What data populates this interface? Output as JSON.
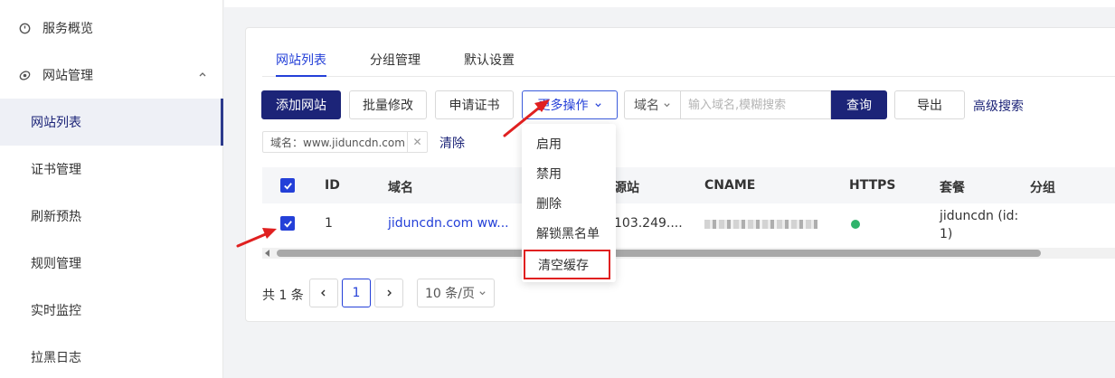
{
  "sidebar": {
    "top_items": [
      {
        "label": "服务概览",
        "icon": "dashboard-icon"
      },
      {
        "label": "网站管理",
        "icon": "globe-icon",
        "expanded": true
      }
    ],
    "sub_items": [
      {
        "label": "网站列表",
        "active": true
      },
      {
        "label": "证书管理"
      },
      {
        "label": "刷新预热"
      },
      {
        "label": "规则管理"
      },
      {
        "label": "实时监控"
      },
      {
        "label": "拉黑日志"
      }
    ]
  },
  "tabs": [
    "网站列表",
    "分组管理",
    "默认设置"
  ],
  "toolbar": {
    "add_site": "添加网站",
    "batch_edit": "批量修改",
    "apply_cert": "申请证书",
    "more_actions": "更多操作",
    "search_field": "域名",
    "search_placeholder": "输入域名,模糊搜索",
    "query": "查询",
    "export": "导出",
    "advanced_search": "高级搜索"
  },
  "filter": {
    "tag": "域名：www.jiduncdn.com",
    "clear": "清除"
  },
  "table": {
    "columns": [
      "ID",
      "域名",
      "源站",
      "CNAME",
      "HTTPS",
      "套餐",
      "分组"
    ],
    "rows": [
      {
        "id": "1",
        "domain": "jiduncdn.com ww...",
        "origin": "103.249....",
        "https_status": "enabled",
        "plan_line1": "jiduncdn (id:",
        "plan_line2": "1)",
        "group": ""
      }
    ]
  },
  "more_menu": {
    "items": [
      "启用",
      "禁用",
      "删除",
      "解锁黑名单",
      "清空缓存"
    ],
    "highlighted": "清空缓存"
  },
  "pagination": {
    "total": "共 1 条",
    "current_page": "1",
    "page_size": "10 条/页"
  },
  "colors": {
    "primary": "#1c2478",
    "accent": "#2440d8",
    "annotation_red": "#e02020",
    "success": "#2fb36b"
  }
}
